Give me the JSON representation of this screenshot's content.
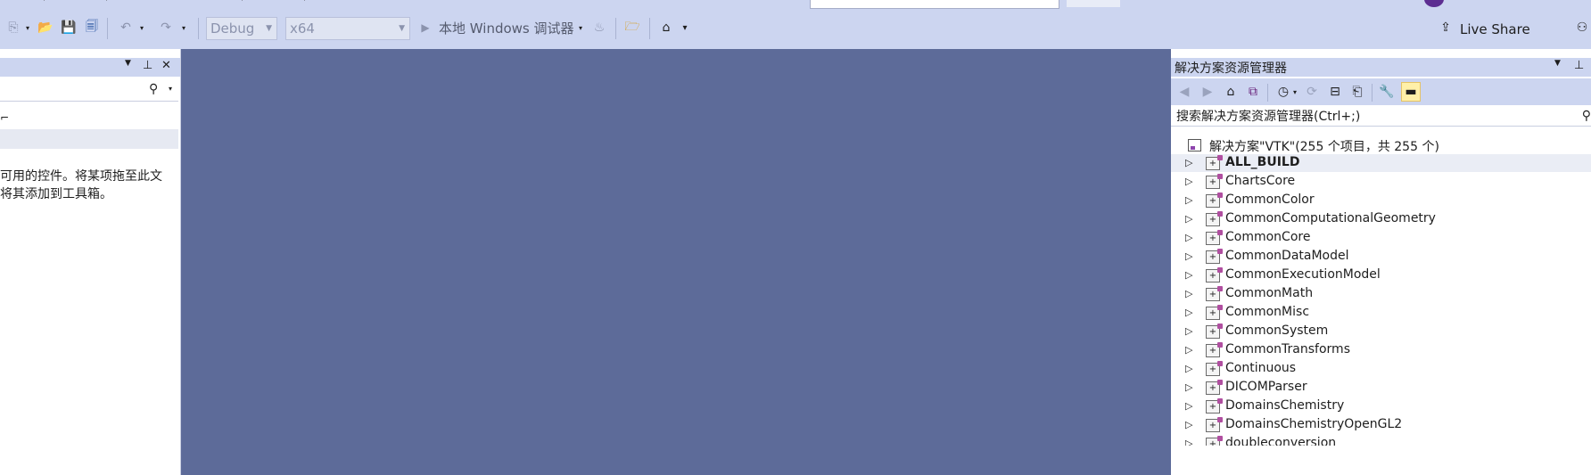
{
  "toolbar": {
    "config": "Debug",
    "platform": "x64",
    "run_target": "本地 Windows 调试器",
    "live_share": "Live Share"
  },
  "left_panel": {
    "message_line1": "可用的控件。将某项拖至此文",
    "message_line2": "将其添加到工具箱。"
  },
  "solution_explorer": {
    "title": "解决方案资源管理器",
    "search_placeholder": "搜索解决方案资源管理器(Ctrl+;)",
    "root": "解决方案\"VTK\"(255 个项目，共 255 个)",
    "projects": [
      "ALL_BUILD",
      "ChartsCore",
      "CommonColor",
      "CommonComputationalGeometry",
      "CommonCore",
      "CommonDataModel",
      "CommonExecutionModel",
      "CommonMath",
      "CommonMisc",
      "CommonSystem",
      "CommonTransforms",
      "Continuous",
      "DICOMParser",
      "DomainsChemistry",
      "DomainsChemistryOpenGL2",
      "doubleconversion"
    ]
  }
}
